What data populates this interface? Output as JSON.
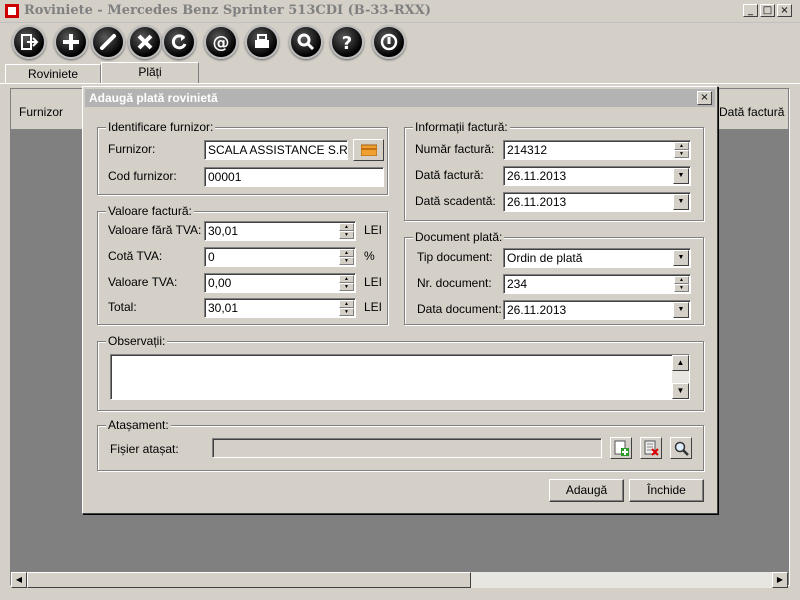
{
  "window": {
    "title": "Roviniete - Mercedes Benz Sprinter 513CDI (B-33-RXX)"
  },
  "toolbar": {
    "icons": [
      "exit-icon",
      "add-icon",
      "edit-icon",
      "delete-icon",
      "refresh-icon",
      "email-icon",
      "print-icon",
      "search-icon",
      "help-icon",
      "power-icon"
    ]
  },
  "tabs": [
    {
      "label": "Roviniete"
    },
    {
      "label": "Plăți"
    }
  ],
  "grid": {
    "col_left": "Furnizor",
    "col_right": "Dată factură"
  },
  "dialog": {
    "title": "Adaugă plată rovinietă",
    "supplier": {
      "legend": "Identificare furnizor:",
      "supplier_label": "Furnizor:",
      "supplier_value": "SCALA ASSISTANCE S.R.L.",
      "code_label": "Cod furnizor:",
      "code_value": "00001"
    },
    "invoice_value": {
      "legend": "Valoare factură:",
      "net_label": "Valoare fără TVA:",
      "net_value": "30,01",
      "net_unit": "LEI",
      "vat_rate_label": "Cotă TVA:",
      "vat_rate_value": "0",
      "vat_rate_unit": "%",
      "vat_label": "Valoare TVA:",
      "vat_value": "0,00",
      "vat_unit": "LEI",
      "total_label": "Total:",
      "total_value": "30,01",
      "total_unit": "LEI"
    },
    "invoice_info": {
      "legend": "Informații factură:",
      "number_label": "Număr factură:",
      "number_value": "214312",
      "date_label": "Dată factură:",
      "date_value": "26.11.2013",
      "due_label": "Dată scadentă:",
      "due_value": "26.11.2013"
    },
    "payment_doc": {
      "legend": "Document plată:",
      "type_label": "Tip document:",
      "type_value": "Ordin de plată",
      "number_label": "Nr. document:",
      "number_value": "234",
      "date_label": "Data document:",
      "date_value": "26.11.2013"
    },
    "notes": {
      "legend": "Observații:",
      "value": ""
    },
    "attachment": {
      "legend": "Atașament:",
      "file_label": "Fișier atașat:",
      "file_value": ""
    },
    "buttons": {
      "add": "Adaugă",
      "close": "Închide"
    }
  }
}
